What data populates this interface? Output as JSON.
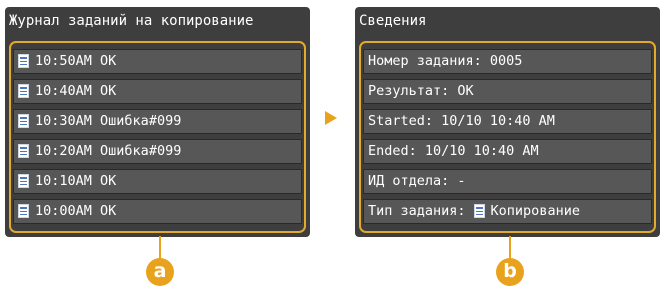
{
  "colors": {
    "accent": "#e9a21b",
    "panel_bg": "#3e3e3e",
    "row_bg": "#575757"
  },
  "job_log": {
    "title": "Журнал заданий на копирование",
    "rows": [
      {
        "icon": "copy-doc-icon",
        "time": "10:50AM",
        "status": "OK"
      },
      {
        "icon": "copy-doc-icon",
        "time": "10:40AM",
        "status": "OK"
      },
      {
        "icon": "copy-doc-icon",
        "time": "10:30AM",
        "status": "Ошибка#099"
      },
      {
        "icon": "copy-doc-icon",
        "time": "10:20AM",
        "status": "Ошибка#099"
      },
      {
        "icon": "copy-doc-icon",
        "time": "10:10AM",
        "status": "OK"
      },
      {
        "icon": "copy-doc-icon",
        "time": "10:00AM",
        "status": "OK"
      }
    ]
  },
  "details": {
    "title": "Сведения",
    "job_number": "Номер задания: 0005",
    "result": "Результат: OK",
    "started": "Started: 10/10 10:40 AM",
    "ended": "Ended: 10/10 10:40 AM",
    "department": "ИД отдела: -",
    "job_type_label": "Тип задания:",
    "job_type_icon": "copy-doc-icon",
    "job_type_value": "Копирование"
  },
  "callouts": {
    "a": "a",
    "b": "b"
  }
}
